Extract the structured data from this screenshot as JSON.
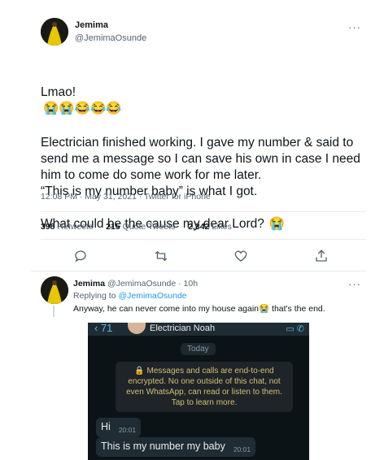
{
  "tweet": {
    "name": "Jemima",
    "handle": "@JemimaOsunde",
    "more": "···",
    "line_first": "Lmao!",
    "emoji_row": [
      "😭",
      "😭",
      "😂",
      "😂",
      "😂"
    ],
    "body": "Electrician finished working. I gave my number & said to send me a message so I can save his own in case I need him to come do some work for me later.\n“This is my number baby” is what I got.\n\nWhat could be the cause my dear Lord?",
    "body_emoji": "😭",
    "meta": "12:08 PM · May 31, 2021 · Twitter for iPhone",
    "stats": {
      "retweets_count": "398",
      "retweets_label": "Retweets",
      "quotes_count": "215",
      "quotes_label": "Quote Tweets",
      "likes_count": "2,342",
      "likes_label": "Likes"
    },
    "actions": [
      "reply-icon",
      "retweet-icon",
      "like-icon",
      "share-icon"
    ]
  },
  "reply": {
    "name": "Jemima",
    "handle_time": "@JemimaOsunde · 10h",
    "more": "···",
    "replying_prefix": "Replying to",
    "replying_handle": "@JemimaOsunde",
    "text_before": "Anyway, he can never come into my house again",
    "emoji": "😭",
    "text_after": " that's the end."
  },
  "whatsapp": {
    "back": "‹ 71",
    "contact": "Electrician Noah",
    "icons": "▭  ✆",
    "date": "Today",
    "encryption": "🔒 Messages and calls are end-to-end encrypted. No one outside of this chat, not even WhatsApp, can read or listen to them. Tap to learn more.",
    "messages": [
      {
        "text": "Hi",
        "time": "20:01"
      },
      {
        "text": "This is my number my baby",
        "time": "20:01"
      }
    ]
  },
  "colors": {
    "accent": "#1d9bf0",
    "wa_bg": "#0c1317",
    "wa_bubble": "#202c33",
    "wa_encryption": "#d4bf74"
  }
}
